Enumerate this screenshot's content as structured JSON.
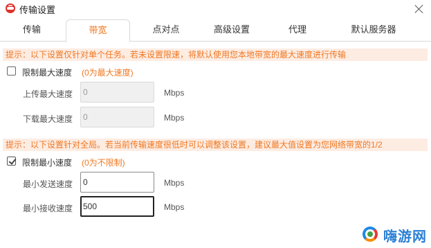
{
  "window": {
    "title": "传输设置"
  },
  "tabs": [
    {
      "label": "传输",
      "active": false
    },
    {
      "label": "带宽",
      "active": true
    },
    {
      "label": "点对点",
      "active": false
    },
    {
      "label": "高级设置",
      "active": false
    },
    {
      "label": "代理",
      "active": false
    },
    {
      "label": "默认服务器",
      "active": false
    }
  ],
  "per_task": {
    "hint": "提示：以下设置仅针对单个任务。若未设置限速，将默认使用您本地带宽的最大速度进行传输",
    "checkbox_label": "限制最大速度",
    "checkbox_checked": false,
    "note": "(0为最大速度)",
    "upload_label": "上传最大速度",
    "upload_value": "0",
    "download_label": "下载最大速度",
    "download_value": "0",
    "unit": "Mbps"
  },
  "global": {
    "hint": "提示：以下设置针对全局。若当前传输速度很低时可以调整该设置，建议最大值设置为您网络带宽的1/2",
    "checkbox_label": "限制最小速度",
    "checkbox_checked": true,
    "note": "(0为不限制)",
    "send_label": "最小发送速度",
    "send_value": "0",
    "receive_label": "最小接收速度",
    "receive_value": "500",
    "unit": "Mbps"
  },
  "watermark": {
    "text": "嗨游网",
    "icon": "haiyou-logo-icon"
  }
}
